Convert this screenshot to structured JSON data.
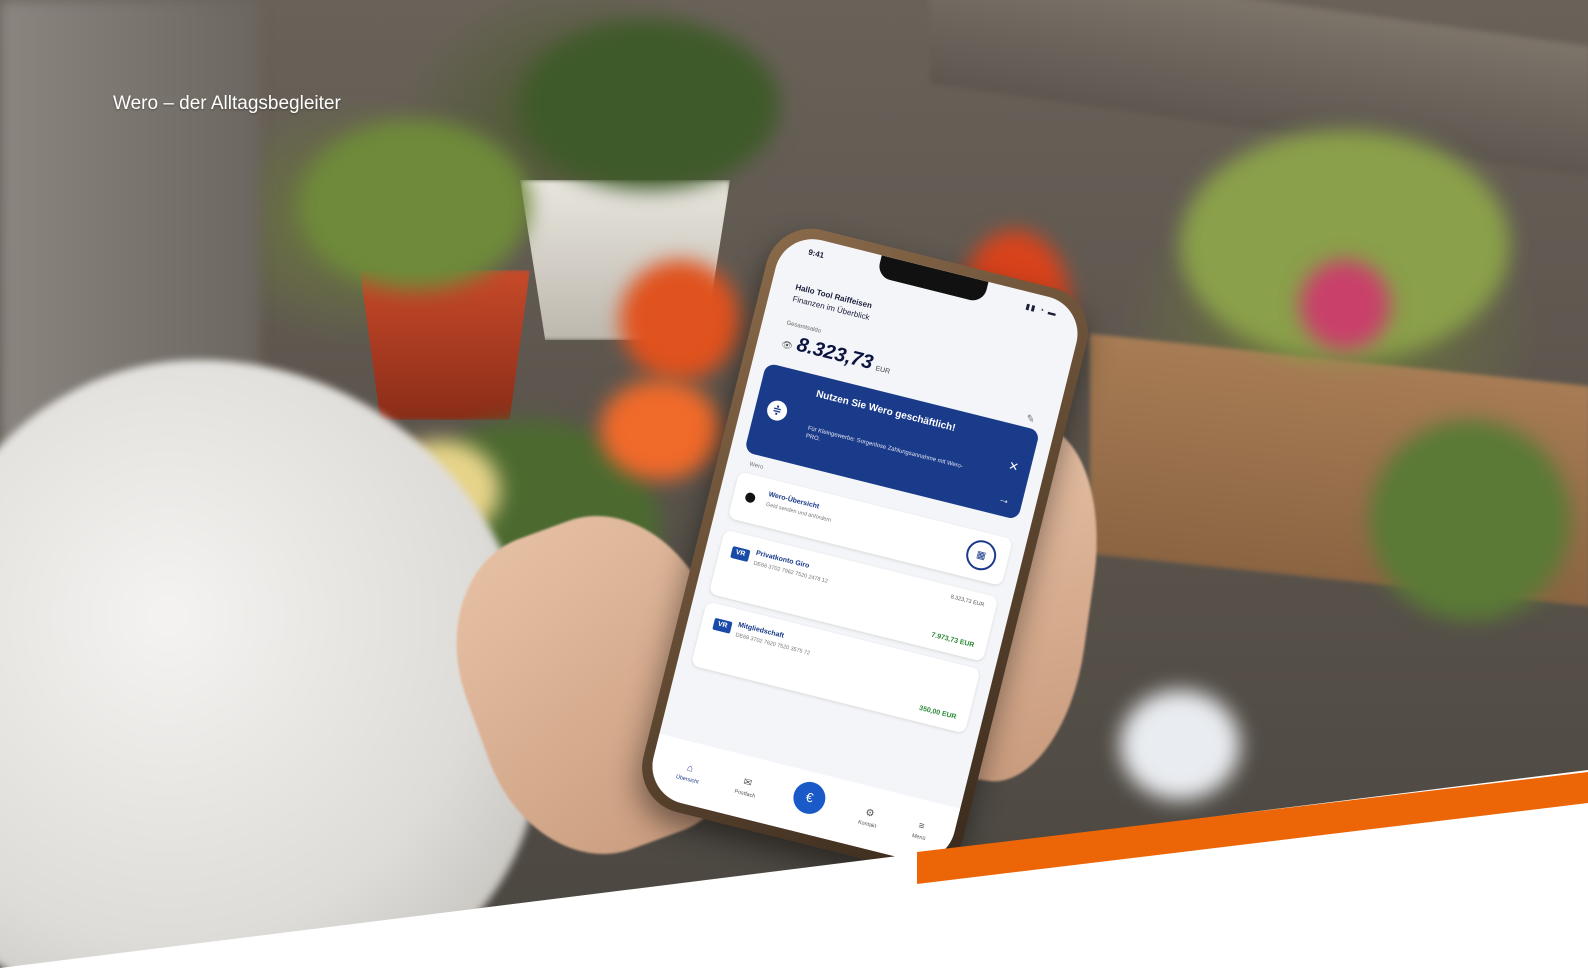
{
  "caption": "Wero – der Alltagsbegleiter",
  "colors": {
    "accent_orange": "#ec6608",
    "bank_blue": "#1a3a8a",
    "positive_green": "#2c8a3a"
  },
  "phone": {
    "status_time": "9:41",
    "greeting": "Hallo Tool Raiffeisen",
    "greeting_sub": "Finanzen im Überblick",
    "balance_label": "Gesamtsaldo",
    "balance_amount": "8.323,73",
    "balance_currency": "EUR",
    "promo": {
      "title": "Nutzen Sie Wero geschäftlich!",
      "text": "Für Kleingewerbe: Sorgenlose Zahlungsannahme mit Wero-PRO.",
      "icon": "wero-icon"
    },
    "section_label": "Wero",
    "wero_card": {
      "title": "Wero-Übersicht",
      "subtitle": "Geld senden und anfordern"
    },
    "accounts": [
      {
        "name": "Privatkonto Giro",
        "iban": "DE66 3702 7962 7520 2478 12",
        "top_value": "8.323,73 EUR",
        "balance": "7.973,73 EUR"
      },
      {
        "name": "Mitgliedschaft",
        "iban": "DE69 3702 7620 7520 3575 72",
        "top_value": "",
        "balance": "350,00 EUR"
      }
    ],
    "tabbar": {
      "tabs": [
        "Übersicht",
        "Postfach",
        "Kontakt",
        "Menü"
      ],
      "center_icon": "euro-icon"
    }
  }
}
